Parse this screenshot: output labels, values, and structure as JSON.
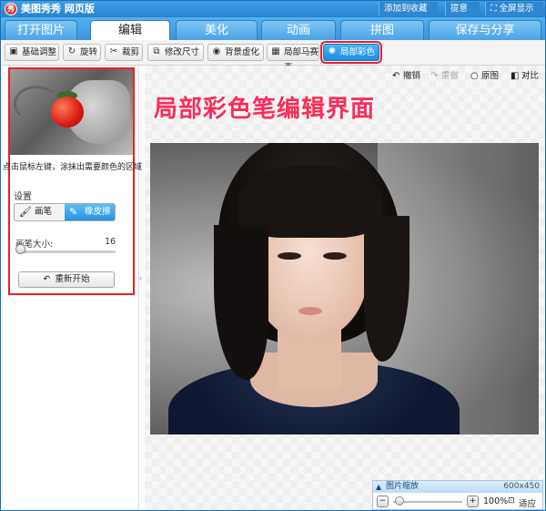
{
  "app": {
    "title": "美图秀秀 网页版",
    "logo_text": "秀",
    "top_buttons": {
      "favorite": "添加到收藏夹",
      "feedback": "提意见",
      "fullscreen": "全屏显示"
    }
  },
  "tabs": [
    {
      "label": "打开图片",
      "active": false
    },
    {
      "label": "编辑",
      "active": true
    },
    {
      "label": "美化",
      "active": false
    },
    {
      "label": "动画",
      "active": false
    },
    {
      "label": "拼图",
      "active": false
    },
    {
      "label": "保存与分享",
      "active": false
    }
  ],
  "toolbar": {
    "items": [
      {
        "label": "基础调整",
        "icon": "image-adjust-icon"
      },
      {
        "label": "旋转",
        "icon": "rotate-icon"
      },
      {
        "label": "裁剪",
        "icon": "scissors-icon"
      },
      {
        "label": "修改尺寸",
        "icon": "resize-icon"
      },
      {
        "label": "背景虚化",
        "icon": "blur-icon"
      },
      {
        "label": "局部马赛克",
        "icon": "mosaic-icon"
      },
      {
        "label": "局部彩色笔",
        "icon": "color-pen-icon",
        "selected": true
      }
    ],
    "highlight_color": "#e8202a",
    "accent_color": "#1d8de0"
  },
  "left_panel": {
    "hint": "点击鼠标左键，涂抹出需要颜色的区域",
    "settings_label": "设置",
    "modes": [
      {
        "label": "画笔",
        "icon": "brush-icon",
        "active": false
      },
      {
        "label": "橡皮擦",
        "icon": "eraser-icon",
        "active": true
      }
    ],
    "brush_size_label": "画笔大小:",
    "brush_size_value": "16",
    "restart_label": "重新开始"
  },
  "canvas": {
    "actions": {
      "undo": "撤销",
      "redo": "重做",
      "original": "原图",
      "compare": "对比"
    },
    "headline": "局部彩色笔编辑界面",
    "headline_color": "#ff2a55"
  },
  "zoom": {
    "title": "图片缩放",
    "dimensions": "600x450",
    "percent": "100%",
    "fit_label": "适应"
  }
}
